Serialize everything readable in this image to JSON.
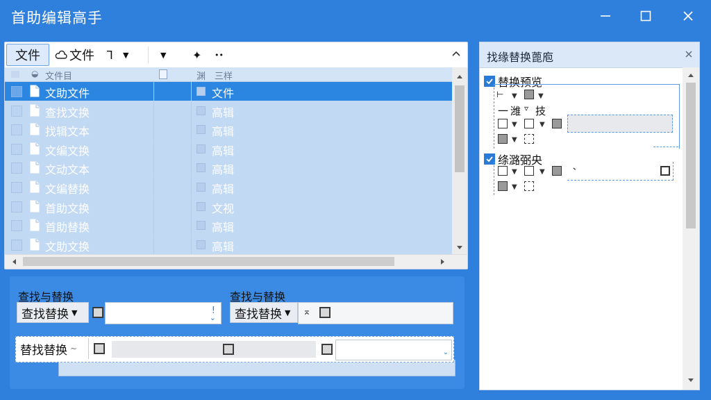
{
  "app": {
    "title": "首助编辑高手",
    "colors": {
      "titlebar": "#2f7fdc",
      "accent": "#2a86e0",
      "selected_row": "#2a86e0"
    }
  },
  "toolbar": {
    "file_tab": "文件",
    "cloud_label": "文件",
    "cloud_icon": "cloud-icon",
    "glyph_a": "ᒣ",
    "glyph_pin": "✦",
    "glyph_more": "••"
  },
  "file_grid": {
    "headers": [
      "文件目",
      "渊",
      "三样"
    ],
    "rows": [
      {
        "name": "文助文件",
        "value": "文件",
        "selected": true
      },
      {
        "name": "查找文换",
        "value": "高辑",
        "selected": false
      },
      {
        "name": "找辑文本",
        "value": "高辑",
        "selected": false
      },
      {
        "name": "文编文换",
        "value": "高辑",
        "selected": false
      },
      {
        "name": "文动文本",
        "value": "高辑",
        "selected": false
      },
      {
        "name": "文编替换",
        "value": "高辑",
        "selected": false
      },
      {
        "name": "首助文换",
        "value": "文视",
        "selected": false
      },
      {
        "name": "首助替换",
        "value": "高辑",
        "selected": false
      },
      {
        "name": "文助文换",
        "value": "高辑",
        "selected": false
      }
    ]
  },
  "find_replace": {
    "label_left": "查找与替换",
    "label_right": "查找与替换",
    "dropdown_left": "查找替换",
    "dropdown_right": "查找替换",
    "dropdown_bottom": "替找替换",
    "dropdown_bottom_caret": "~",
    "right_glyph": "⌅"
  },
  "right_panel": {
    "title": "找缘替换蓖庖",
    "section1": "替换预览",
    "section1_row2": [
      "一",
      "潍",
      "▿",
      "技"
    ],
    "section2": "绦潞弼央",
    "section2_tick": "、"
  }
}
